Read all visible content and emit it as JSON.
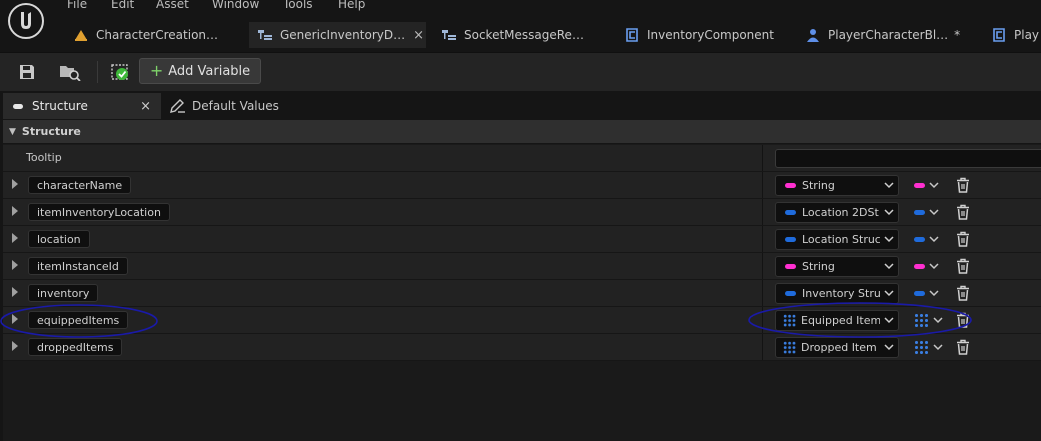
{
  "menu": [
    "File",
    "Edit",
    "Asset",
    "Window",
    "Tools",
    "Help"
  ],
  "tabs": [
    {
      "label": "CharacterCreation…",
      "icon": "widget-blueprint-icon"
    },
    {
      "label": "GenericInventoryD…",
      "icon": "structure-icon",
      "close": "×"
    },
    {
      "label": "SocketMessageRe…",
      "icon": "structure-icon"
    },
    {
      "label": "InventoryComponent",
      "icon": "component-blueprint-icon"
    },
    {
      "label": "PlayerCharacterBl…",
      "icon": "character-blueprint-icon",
      "dirty": "*"
    },
    {
      "label": "Play",
      "icon": "component-blueprint-icon"
    }
  ],
  "toolbar": {
    "add_variable_label": "Add Variable"
  },
  "panel_tabs": {
    "structure_label": "Structure",
    "structure_close": "×",
    "defaults_label": "Default Values"
  },
  "section": {
    "title": "Structure"
  },
  "tooltip": {
    "label": "Tooltip",
    "value": ""
  },
  "colors": {
    "string": "#ff2fd0",
    "struct": "#1f6bdc"
  },
  "variables": [
    {
      "name": "characterName",
      "type": "String",
      "pin": "string",
      "container": "single"
    },
    {
      "name": "itemInventoryLocation",
      "type": "Location 2DSt",
      "pin": "struct",
      "container": "single"
    },
    {
      "name": "location",
      "type": "Location Struc",
      "pin": "struct",
      "container": "single"
    },
    {
      "name": "itemInstanceId",
      "type": "String",
      "pin": "string",
      "container": "single"
    },
    {
      "name": "inventory",
      "type": "Inventory Stru",
      "pin": "struct",
      "container": "single"
    },
    {
      "name": "equippedItems",
      "type": "Equipped Item",
      "pin": "struct",
      "container": "map"
    },
    {
      "name": "droppedItems",
      "type": "Dropped Item",
      "pin": "struct",
      "container": "map"
    }
  ]
}
